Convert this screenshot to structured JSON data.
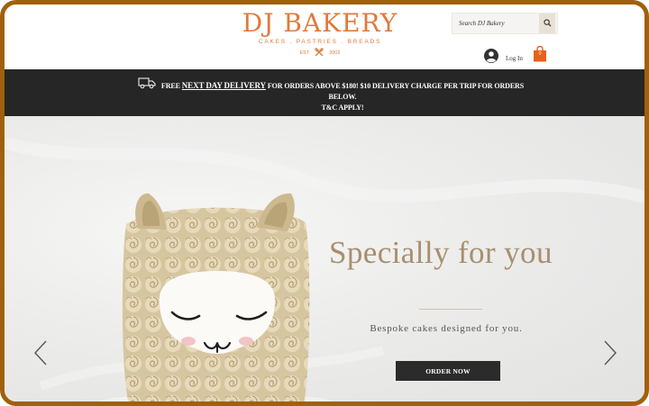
{
  "header": {
    "logo_title": "DJ BAKERY",
    "logo_tagline": "CAKES . PASTRIES . BREADS",
    "logo_est": "EST",
    "logo_year": "2002",
    "search_placeholder": "Search DJ Bakery",
    "search_icon": "search-icon",
    "login_label": "Log In",
    "cart_count": "0",
    "brand_color": "#e07a3c",
    "cart_color": "#e8601c"
  },
  "banner": {
    "free_label": "FREE",
    "highlight": "NEXT DAY DELIVERY",
    "text_line1": "FOR ORDERS ABOVE $180! $10 DELIVERY CHARGE PER TRIP FOR ORDERS BELOW.",
    "text_line2": "T&C APPLY!",
    "icon": "truck-icon",
    "background": "#262626"
  },
  "hero": {
    "headline": "Specially for you",
    "subtext": "Bespoke cakes designed for you.",
    "cta_label": "ORDER NOW",
    "prev_icon": "chevron-left-icon",
    "next_icon": "chevron-right-icon",
    "headline_color": "#a88f6f"
  }
}
